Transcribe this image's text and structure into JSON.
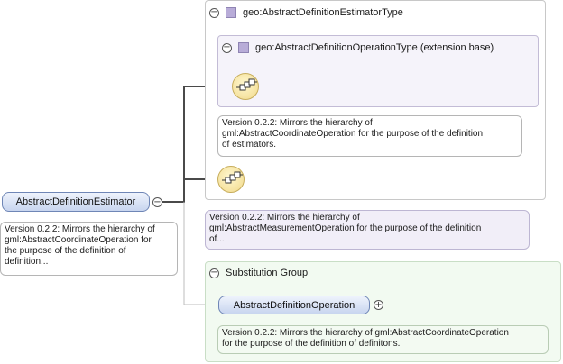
{
  "root_element": {
    "name": "AbstractDefinitionEstimator",
    "note": [
      "Version 0.2.2: Mirrors the hierarchy of",
      "gml:AbstractCoordinateOperation for",
      "the purpose of the definition of",
      "definition..."
    ]
  },
  "type_panel": {
    "title": "geo:AbstractDefinitionEstimatorType",
    "extension": {
      "title": "geo:AbstractDefinitionOperationType (extension base)"
    },
    "inner_note": [
      "Version 0.2.2: Mirrors the hierarchy of",
      "gml:AbstractCoordinateOperation for the purpose of the definition",
      "of estimators."
    ],
    "type_note": [
      "Version 0.2.2: Mirrors the hierarchy of",
      "gml:AbstractMeasurementOperation for the purpose of the definition",
      "of..."
    ]
  },
  "substitution_group": {
    "title": "Substitution Group",
    "element": "AbstractDefinitionOperation",
    "note": [
      "Version 0.2.2: Mirrors the hierarchy of gml:AbstractCoordinateOperation",
      "for the purpose of the definition of definitons."
    ]
  },
  "toggles": {
    "collapse": "⊖",
    "expand": "+"
  },
  "colors": {
    "type_icon": "#b8acd8",
    "element_fill": "#c8d5ef",
    "substitution_bg": "#f2faf1",
    "extension_bg": "#f5f3fa"
  },
  "icons": [
    "sequence-compositor-icon",
    "complex-type-icon",
    "collapse-icon",
    "expand-icon"
  ]
}
